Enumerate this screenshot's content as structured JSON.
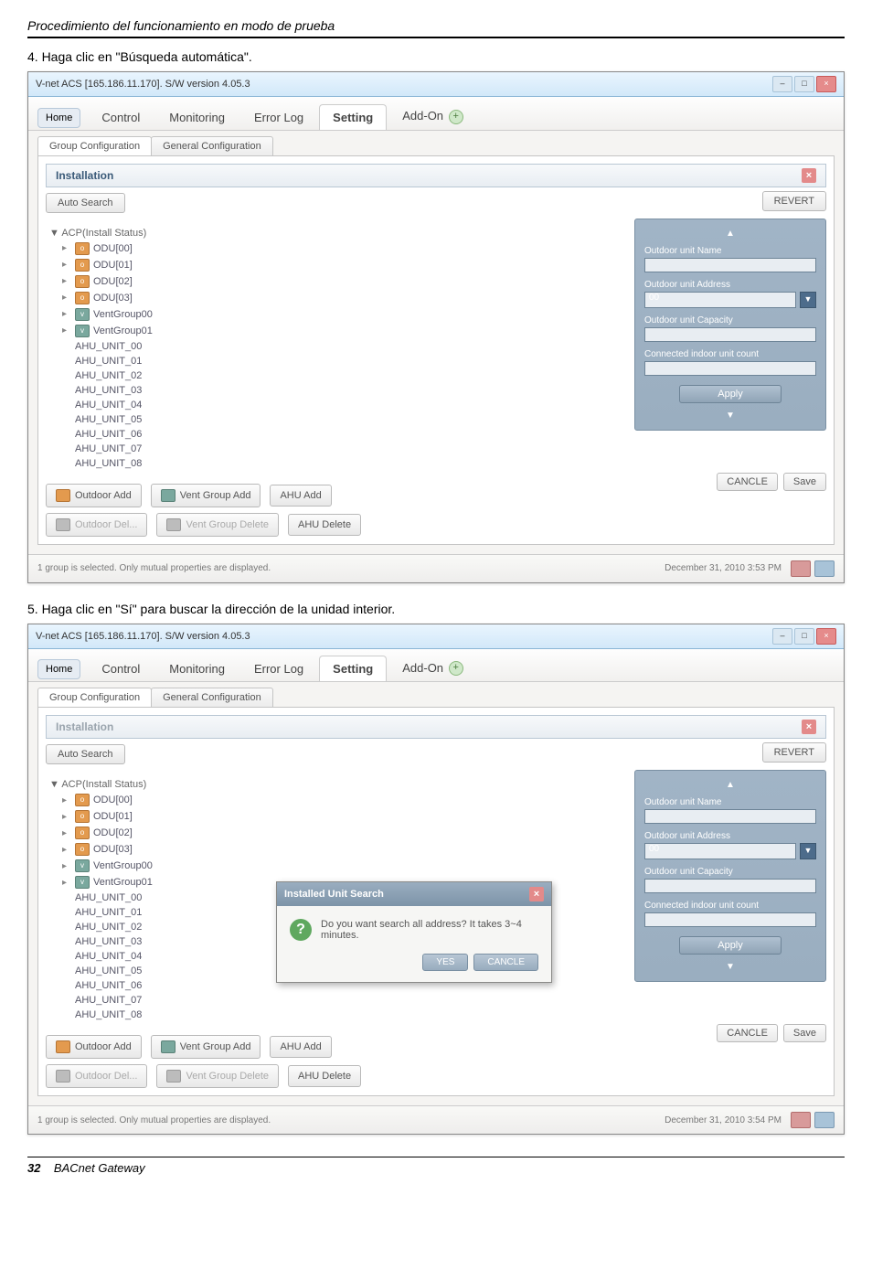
{
  "doc": {
    "section_title": "Procedimiento del funcionamiento en modo de prueba",
    "step4": "4. Haga clic en \"Búsqueda automática\".",
    "step5": "5. Haga clic en \"Sí\" para buscar la dirección de la unidad interior.",
    "page_number": "32",
    "footer_name": "BACnet Gateway"
  },
  "window": {
    "title": "V-net ACS [165.186.11.170].   S/W version 4.05.3",
    "minimize": "–",
    "maximize": "□",
    "close": "×"
  },
  "tabs": {
    "home": "Home",
    "items": [
      "Control",
      "Monitoring",
      "Error Log",
      "Setting",
      "Add-On"
    ],
    "active_index": 3
  },
  "subtabs": {
    "items": [
      "Group Configuration",
      "General Configuration"
    ],
    "active_index": 0
  },
  "section": {
    "title": "Installation",
    "close": "×"
  },
  "auto_search": "Auto Search",
  "revert": "REVERT",
  "tree": {
    "root": "▼ ACP(Install Status)",
    "odu": [
      "ODU[00]",
      "ODU[01]",
      "ODU[02]",
      "ODU[03]"
    ],
    "vent": [
      "VentGroup00",
      "VentGroup01"
    ],
    "ahu": [
      "AHU_UNIT_00",
      "AHU_UNIT_01",
      "AHU_UNIT_02",
      "AHU_UNIT_03",
      "AHU_UNIT_04",
      "AHU_UNIT_05",
      "AHU_UNIT_06",
      "AHU_UNIT_07",
      "AHU_UNIT_08"
    ]
  },
  "side_panel": {
    "name_label": "Outdoor unit Name",
    "address_label": "Outdoor unit Address",
    "address_value": "00",
    "capacity_label": "Outdoor unit Capacity",
    "connected_label": "Connected indoor unit count",
    "apply": "Apply",
    "scroll_up": "▲",
    "scroll_down": "▼"
  },
  "bottom": {
    "outdoor_add": "Outdoor Add",
    "vent_group_add": "Vent Group Add",
    "ahu_add": "AHU Add",
    "outdoor_del": "Outdoor Del...",
    "vent_group_delete": "Vent Group Delete",
    "ahu_delete": "AHU Delete",
    "cancle": "CANCLE",
    "save": "Save"
  },
  "status": {
    "left": "1 group is selected. Only mutual properties are displayed.",
    "right1": "December 31, 2010  3:53 PM",
    "right2": "December 31, 2010  3:54 PM"
  },
  "dialog": {
    "title": "Installed Unit Search",
    "close": "×",
    "question_mark": "?",
    "message": "Do you want search all address? It takes 3~4 minutes.",
    "yes": "YES",
    "cancle": "CANCLE"
  }
}
